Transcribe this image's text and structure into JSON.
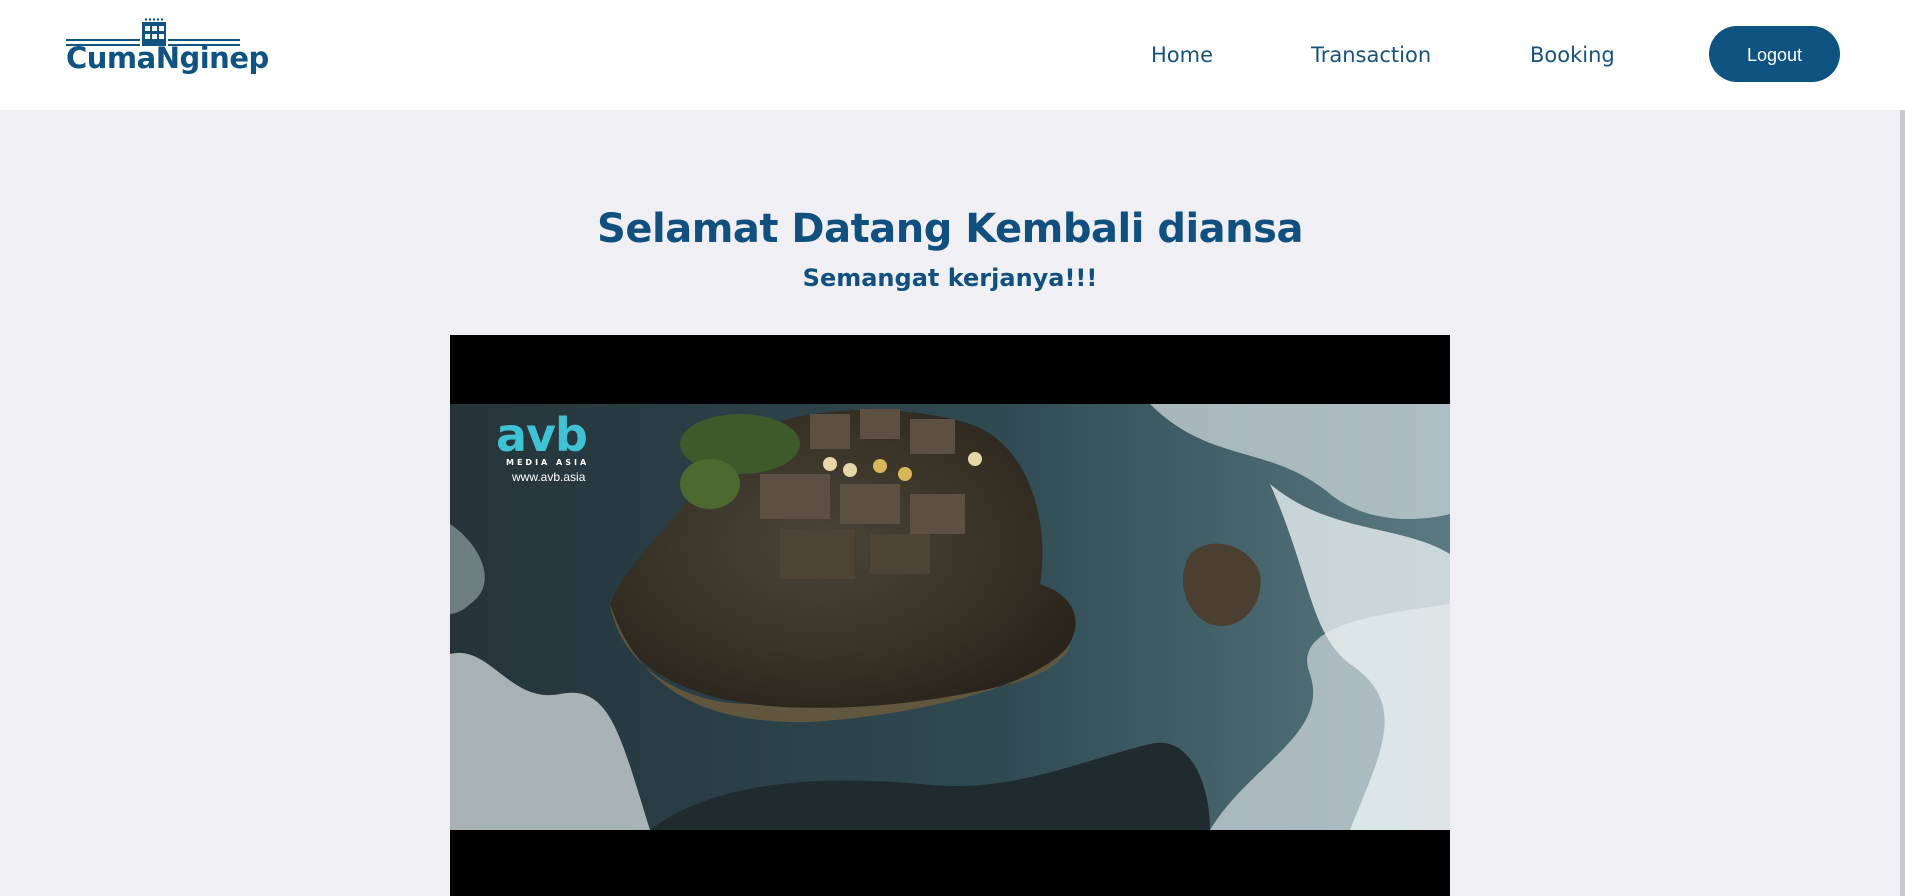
{
  "header": {
    "logo_text": "CumaNginep",
    "nav": {
      "home": "Home",
      "transaction": "Transaction",
      "booking": "Booking"
    },
    "logout_label": "Logout",
    "brand_color": "#0f5383"
  },
  "main": {
    "welcome_title": "Selamat Datang Kembali diansa",
    "welcome_subtitle": "Semangat kerjanya!!!",
    "video": {
      "watermark_brand": "avb",
      "watermark_tagline": "MEDIA ASIA",
      "watermark_url": "www.avb.asia"
    }
  },
  "colors": {
    "page_background": "#efeff4",
    "header_background": "#ffffff",
    "accent": "#0f5383"
  }
}
